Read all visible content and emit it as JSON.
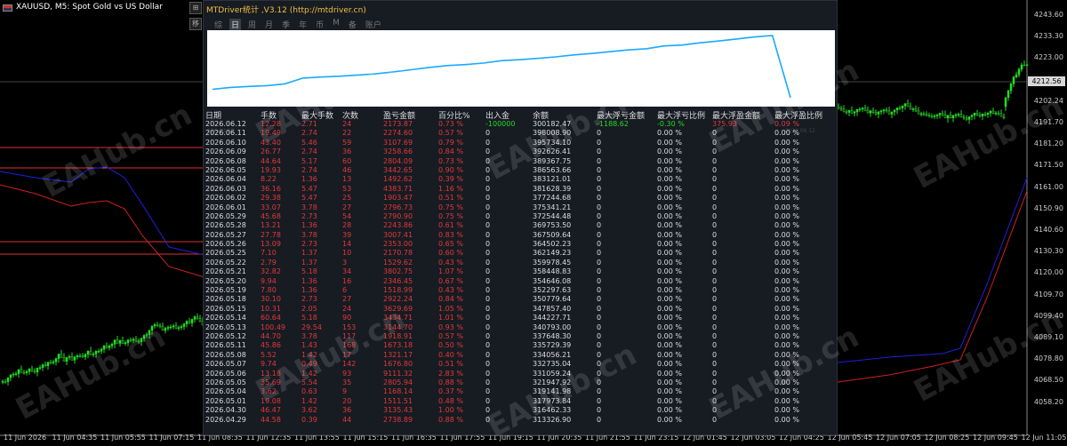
{
  "symbol_title": "XAUUSD, M5:  Spot Gold vs US Dollar",
  "colors": {
    "bull": "#22dd22",
    "bear": "#222222",
    "blue_line": "#2020e0",
    "red_line": "#d02020",
    "accent": "#f0c040",
    "equity_line": "#1aa8ff"
  },
  "price_axis": [
    "4243.60",
    "4233.30",
    "4223.00",
    "4212.56",
    "4202.24",
    "4191.70",
    "4181.20",
    "4171.50",
    "4161.00",
    "4150.90",
    "4140.60",
    "4130.30",
    "4120.00",
    "4109.70",
    "4099.40",
    "4089.10",
    "4078.80",
    "4068.50",
    "4058.20"
  ],
  "current_price": "4212.56",
  "time_axis": [
    "11 Jun 2026",
    "11 Jun 04:35",
    "11 Jun 05:55",
    "11 Jun 07:15",
    "11 Jun 08:35",
    "11 Jun 12:35",
    "11 Jun 13:55",
    "11 Jun 15:15",
    "11 Jun 16:35",
    "11 Jun 17:55",
    "11 Jun 19:15",
    "11 Jun 20:35",
    "11 Jun 21:55",
    "11 Jun 23:15",
    "12 Jun 01:45",
    "12 Jun 03:05",
    "12 Jun 04:25",
    "12 Jun 05:45",
    "12 Jun 07:05",
    "12 Jun 08:25",
    "12 Jun 09:45",
    "12 Jun 11:05"
  ],
  "watermark": "EAHub.cn",
  "side_buttons": [
    "⊞",
    "移"
  ],
  "panel": {
    "title": "MTDriver统计 ,V3.12 (http://mtdriver.cn)",
    "tabs": [
      "综",
      "日",
      "周",
      "月",
      "季",
      "年",
      "币",
      "M",
      "备",
      "账户"
    ],
    "active_tab": 1,
    "equity_start_label": "026.03.05",
    "equity_end_label": "2026.06.12",
    "headers": [
      "日期",
      "手数",
      "最大手数",
      "次数",
      "盈亏金额",
      "百分比%",
      "出入金",
      "余额",
      "最大浮亏金额",
      "最大浮亏比例",
      "最大浮盈金额",
      "最大浮盈比例"
    ],
    "rows": [
      [
        "2026.06.12",
        "12.28",
        "2.71",
        "24",
        "2173.87",
        "0.73 %",
        "-100000",
        "300182.47",
        "-1188.62",
        "-0.30 %",
        "375.93",
        "0.09 %"
      ],
      [
        "2026.06.11",
        "19.49",
        "2.74",
        "22",
        "2274.60",
        "0.57 %",
        "0",
        "398008.90",
        "0",
        "0.00 %",
        "0",
        "0.00 %"
      ],
      [
        "2026.06.10",
        "43.40",
        "5.46",
        "59",
        "3107.69",
        "0.79 %",
        "0",
        "395734.10",
        "0",
        "0.00 %",
        "0",
        "0.00 %"
      ],
      [
        "2026.06.09",
        "26.77",
        "2.74",
        "36",
        "3258.66",
        "0.84 %",
        "0",
        "392626.41",
        "0",
        "0.00 %",
        "0",
        "0.00 %"
      ],
      [
        "2026.06.08",
        "44.64",
        "5.17",
        "60",
        "2804.09",
        "0.73 %",
        "0",
        "389367.75",
        "0",
        "0.00 %",
        "0",
        "0.00 %"
      ],
      [
        "2026.06.05",
        "19.93",
        "2.74",
        "46",
        "3442.65",
        "0.90 %",
        "0",
        "386563.66",
        "0",
        "0.00 %",
        "0",
        "0.00 %"
      ],
      [
        "2026.06.04",
        "8.22",
        "1.36",
        "13",
        "1492.62",
        "0.39 %",
        "0",
        "383121.01",
        "0",
        "0.00 %",
        "0",
        "0.00 %"
      ],
      [
        "2026.06.03",
        "36.16",
        "5.47",
        "53",
        "4383.71",
        "1.16 %",
        "0",
        "381628.39",
        "0",
        "0.00 %",
        "0",
        "0.00 %"
      ],
      [
        "2026.06.02",
        "29.38",
        "5.47",
        "25",
        "1903.47",
        "0.51 %",
        "0",
        "377244.68",
        "0",
        "0.00 %",
        "0",
        "0.00 %"
      ],
      [
        "2026.06.01",
        "33.07",
        "3.78",
        "27",
        "2796.73",
        "0.75 %",
        "0",
        "375341.21",
        "0",
        "0.00 %",
        "0",
        "0.00 %"
      ],
      [
        "2026.05.29",
        "45.68",
        "2.73",
        "54",
        "2790.90",
        "0.75 %",
        "0",
        "372544.48",
        "0",
        "0.00 %",
        "0",
        "0.00 %"
      ],
      [
        "2026.05.28",
        "13.21",
        "1.36",
        "28",
        "2243.86",
        "0.61 %",
        "0",
        "369753.50",
        "0",
        "0.00 %",
        "0",
        "0.00 %"
      ],
      [
        "2026.05.27",
        "27.78",
        "3.78",
        "39",
        "3007.41",
        "0.83 %",
        "0",
        "367509.64",
        "0",
        "0.00 %",
        "0",
        "0.00 %"
      ],
      [
        "2026.05.26",
        "13.09",
        "2.73",
        "14",
        "2353.00",
        "0.65 %",
        "0",
        "364502.23",
        "0",
        "0.00 %",
        "0",
        "0.00 %"
      ],
      [
        "2026.05.25",
        "7.10",
        "1.37",
        "10",
        "2170.78",
        "0.60 %",
        "0",
        "362149.23",
        "0",
        "0.00 %",
        "0",
        "0.00 %"
      ],
      [
        "2026.05.22",
        "2.79",
        "1.37",
        "3",
        "1529.62",
        "0.43 %",
        "0",
        "359978.45",
        "0",
        "0.00 %",
        "0",
        "0.00 %"
      ],
      [
        "2026.05.21",
        "32.82",
        "5.18",
        "34",
        "3802.75",
        "1.07 %",
        "0",
        "358448.83",
        "0",
        "0.00 %",
        "0",
        "0.00 %"
      ],
      [
        "2026.05.20",
        "9.94",
        "1.36",
        "16",
        "2346.45",
        "0.67 %",
        "0",
        "354646.08",
        "0",
        "0.00 %",
        "0",
        "0.00 %"
      ],
      [
        "2026.05.19",
        "7.80",
        "1.36",
        "6",
        "1518.99",
        "0.43 %",
        "0",
        "352297.63",
        "0",
        "0.00 %",
        "0",
        "0.00 %"
      ],
      [
        "2026.05.18",
        "30.10",
        "2.73",
        "27",
        "2922.24",
        "0.84 %",
        "0",
        "350779.64",
        "0",
        "0.00 %",
        "0",
        "0.00 %"
      ],
      [
        "2026.05.15",
        "10.31",
        "2.05",
        "24",
        "3629.69",
        "1.05 %",
        "0",
        "347857.40",
        "0",
        "0.00 %",
        "0",
        "0.00 %"
      ],
      [
        "2026.05.14",
        "60.64",
        "5.18",
        "90",
        "3434.71",
        "1.01 %",
        "0",
        "344227.71",
        "0",
        "0.00 %",
        "0",
        "0.00 %"
      ],
      [
        "2026.05.13",
        "100.49",
        "29.54",
        "153",
        "3144.70",
        "0.93 %",
        "0",
        "340793.00",
        "0",
        "0.00 %",
        "0",
        "0.00 %"
      ],
      [
        "2026.05.12",
        "44.70",
        "3.78",
        "117",
        "1918.91",
        "0.57 %",
        "0",
        "337648.30",
        "0",
        "0.00 %",
        "0",
        "0.00 %"
      ],
      [
        "2026.05.11",
        "45.86",
        "1.43",
        "168",
        "1673.18",
        "0.50 %",
        "0",
        "335729.39",
        "0",
        "0.00 %",
        "0",
        "0.00 %"
      ],
      [
        "2026.05.08",
        "5.52",
        "1.42",
        "17",
        "1321.17",
        "0.40 %",
        "0",
        "334056.21",
        "0",
        "0.00 %",
        "0",
        "0.00 %"
      ],
      [
        "2026.05.07",
        "9.74",
        "0.49",
        "142",
        "1676.80",
        "0.51 %",
        "0",
        "332735.04",
        "0",
        "0.00 %",
        "0",
        "0.00 %"
      ],
      [
        "2026.05.06",
        "13.18",
        "1.42",
        "93",
        "9111.32",
        "2.83 %",
        "0",
        "331059.24",
        "0",
        "0.00 %",
        "0",
        "0.00 %"
      ],
      [
        "2026.05.05",
        "35.69",
        "5.54",
        "35",
        "2805.94",
        "0.88 %",
        "0",
        "321947.92",
        "0",
        "0.00 %",
        "0",
        "0.00 %"
      ],
      [
        "2026.05.04",
        "3.62",
        "0.63",
        "9",
        "1168.14",
        "0.37 %",
        "0",
        "319141.98",
        "0",
        "0.00 %",
        "0",
        "0.00 %"
      ],
      [
        "2026.05.01",
        "19.08",
        "1.42",
        "20",
        "1511.51",
        "0.48 %",
        "0",
        "317973.84",
        "0",
        "0.00 %",
        "0",
        "0.00 %"
      ],
      [
        "2026.04.30",
        "46.47",
        "3.62",
        "36",
        "3135.43",
        "1.00 %",
        "0",
        "316462.33",
        "0",
        "0.00 %",
        "0",
        "0.00 %"
      ],
      [
        "2026.04.29",
        "44.58",
        "0.39",
        "44",
        "2738.89",
        "0.88 %",
        "0",
        "313326.90",
        "0",
        "0.00 %",
        "0",
        "0.00 %"
      ]
    ]
  }
}
